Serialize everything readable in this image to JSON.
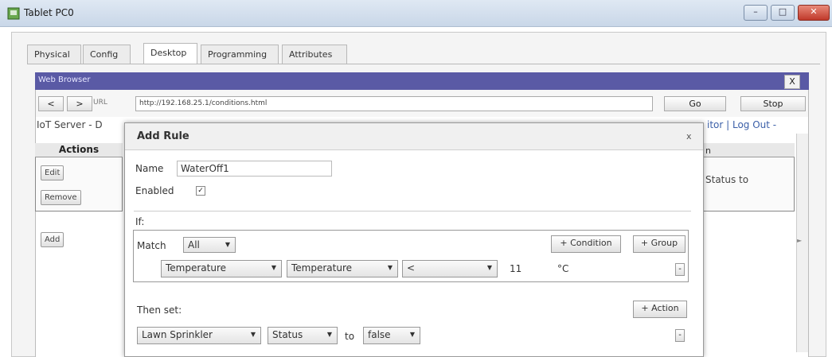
{
  "window": {
    "title": "Tablet PC0"
  },
  "tabs": [
    {
      "label": "Physical"
    },
    {
      "label": "Config"
    },
    {
      "label": "Desktop"
    },
    {
      "label": "Programming"
    },
    {
      "label": "Attributes"
    }
  ],
  "browser": {
    "title": "Web Browser",
    "close_label": "X",
    "back_label": "<",
    "forward_label": ">",
    "url_label": "URL",
    "url": "http://192.168.25.1/conditions.html",
    "go_label": "Go",
    "stop_label": "Stop"
  },
  "page": {
    "server_title": "IoT Server - D",
    "top_links": "itor | Log Out -",
    "actions_header": "Actions",
    "edit_label": "Edit",
    "remove_label": "Remove",
    "add_label": "Add",
    "right_header": "n",
    "right_status": "Status to"
  },
  "modal": {
    "title": "Add Rule",
    "close_label": "x",
    "name_label": "Name",
    "name_value": "WaterOff1",
    "enabled_label": "Enabled",
    "enabled_check": "✓",
    "if_label": "If:",
    "match_label": "Match",
    "match_value": "All",
    "add_condition_label": "+ Condition",
    "add_group_label": "+ Group",
    "condition": {
      "device": "Temperature",
      "property": "Temperature",
      "operator": "<",
      "value": "11",
      "unit": "°C"
    },
    "minus_label": "-",
    "then_label": "Then set:",
    "add_action_label": "+ Action",
    "action": {
      "device": "Lawn Sprinkler",
      "property": "Status",
      "to_label": "to",
      "value": "false"
    }
  }
}
